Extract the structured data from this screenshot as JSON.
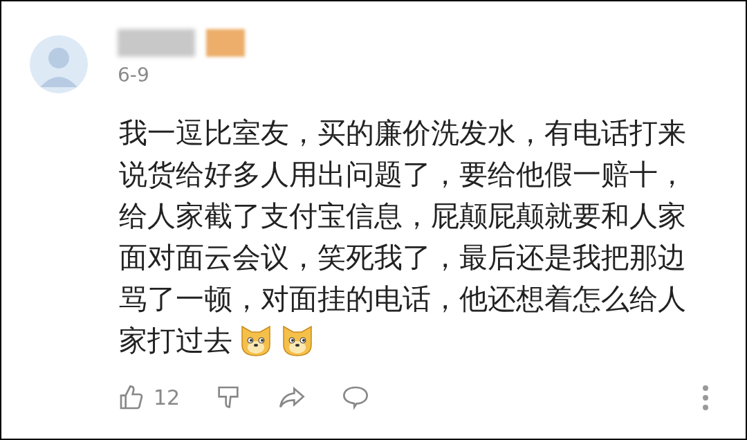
{
  "comment": {
    "date": "6-9",
    "lines": [
      "我一逗比室友，买的廉价洗发水，有电话打来",
      "说货给好多人用出问题了，要给他假一赔十，",
      "给人家截了支付宝信息，屁颠屁颠就要和人家",
      "面对面云会议，笑死我了，最后还是我把那边",
      "骂了一顿，对面挂的电话，他还想着怎么给人",
      "家打过去"
    ],
    "like_count": "12"
  }
}
